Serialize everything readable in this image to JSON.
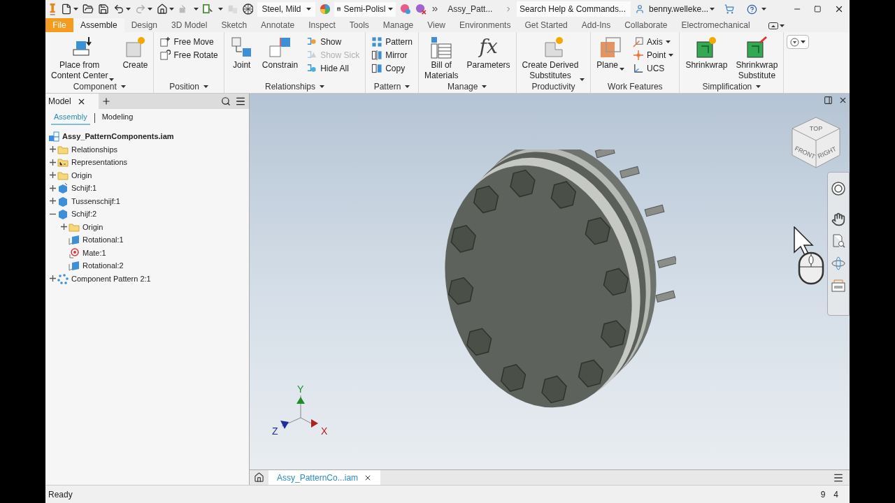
{
  "title_bar": {
    "material": "Steel, Mild",
    "appearance": "Semi-Polisl",
    "document_title": "Assy_Patt...",
    "search": {
      "placeholder": "Search Help & Commands..."
    },
    "user": "benny.welleke..."
  },
  "tabs": [
    {
      "label": "File",
      "kind": "file",
      "selected": false
    },
    {
      "label": "Assemble",
      "kind": "tab",
      "selected": true
    },
    {
      "label": "Design",
      "kind": "tab",
      "selected": false
    },
    {
      "label": "3D Model",
      "kind": "tab",
      "selected": false
    },
    {
      "label": "Sketch",
      "kind": "tab",
      "selected": false
    },
    {
      "label": "Annotate",
      "kind": "tab",
      "selected": false
    },
    {
      "label": "Inspect",
      "kind": "tab",
      "selected": false
    },
    {
      "label": "Tools",
      "kind": "tab",
      "selected": false
    },
    {
      "label": "Manage",
      "kind": "tab",
      "selected": false
    },
    {
      "label": "View",
      "kind": "tab",
      "selected": false
    },
    {
      "label": "Environments",
      "kind": "tab",
      "selected": false
    },
    {
      "label": "Get Started",
      "kind": "tab",
      "selected": false
    },
    {
      "label": "Add-Ins",
      "kind": "tab",
      "selected": false
    },
    {
      "label": "Collaborate",
      "kind": "tab",
      "selected": false
    },
    {
      "label": "Electromechanical",
      "kind": "tab",
      "selected": false
    }
  ],
  "ribbon": [
    {
      "title": "Component",
      "menu": true,
      "tools": [
        {
          "label": "Place from\nContent Center",
          "kind": "large",
          "dropdown": true,
          "disabled": false
        },
        {
          "label": "Create",
          "kind": "large",
          "dropdown": false,
          "disabled": false
        }
      ]
    },
    {
      "title": "Position",
      "menu": true,
      "tools": [
        {
          "label": "Free Move",
          "kind": "small",
          "dropdown": false,
          "disabled": false
        },
        {
          "label": "Free Rotate",
          "kind": "small",
          "dropdown": false,
          "disabled": false
        }
      ]
    },
    {
      "title": "Relationships",
      "menu": true,
      "tools": [
        {
          "label": "Joint",
          "kind": "large",
          "dropdown": false,
          "disabled": false
        },
        {
          "label": "Constrain",
          "kind": "large",
          "dropdown": false,
          "disabled": false
        },
        {
          "label": "Show",
          "kind": "small",
          "dropdown": false,
          "disabled": false
        },
        {
          "label": "Show Sick",
          "kind": "small",
          "dropdown": false,
          "disabled": true
        },
        {
          "label": "Hide All",
          "kind": "small",
          "dropdown": false,
          "disabled": false
        }
      ]
    },
    {
      "title": "Pattern",
      "menu": true,
      "tools": [
        {
          "label": "Pattern",
          "kind": "small",
          "dropdown": false,
          "disabled": false
        },
        {
          "label": "Mirror",
          "kind": "small",
          "dropdown": false,
          "disabled": false
        },
        {
          "label": "Copy",
          "kind": "small",
          "dropdown": false,
          "disabled": false
        }
      ]
    },
    {
      "title": "Manage",
      "menu": true,
      "tools": [
        {
          "label": "Bill of\nMaterials",
          "kind": "large",
          "dropdown": false,
          "disabled": false
        },
        {
          "label": "Parameters",
          "kind": "large",
          "glyph": "fx",
          "dropdown": false,
          "disabled": false
        }
      ]
    },
    {
      "title": "Productivity",
      "menu": false,
      "tools": [
        {
          "label": "Create Derived\nSubstitutes",
          "kind": "large",
          "dropdown": true,
          "disabled": false
        }
      ]
    },
    {
      "title": "Work Features",
      "menu": false,
      "tools": [
        {
          "label": "Plane",
          "kind": "large",
          "dropdown": true,
          "disabled": false
        },
        {
          "label": "Axis",
          "kind": "small",
          "dropdown": true,
          "disabled": false
        },
        {
          "label": "Point",
          "kind": "small",
          "dropdown": true,
          "disabled": false
        },
        {
          "label": "UCS",
          "kind": "small",
          "dropdown": false,
          "disabled": false
        }
      ]
    },
    {
      "title": "Simplification",
      "menu": true,
      "tools": [
        {
          "label": "Shrinkwrap",
          "kind": "large",
          "dropdown": false,
          "disabled": false
        },
        {
          "label": "Shrinkwrap\nSubstitute",
          "kind": "large",
          "dropdown": false,
          "disabled": false
        }
      ]
    }
  ],
  "browser": {
    "tab": "Model",
    "subtabs": [
      {
        "label": "Assembly",
        "selected": true
      },
      {
        "label": "Modeling",
        "selected": false
      }
    ],
    "tree": {
      "label": "Assy_PatternComponents.iam",
      "kind": "assembly",
      "children": [
        {
          "label": "Relationships",
          "kind": "folder",
          "expanded": false
        },
        {
          "label": "Representations",
          "kind": "representations",
          "expanded": false
        },
        {
          "label": "Origin",
          "kind": "folder",
          "expanded": false
        },
        {
          "label": "Schijf:1",
          "kind": "part-grounded",
          "expanded": false
        },
        {
          "label": "Tussenschijf:1",
          "kind": "part",
          "expanded": false
        },
        {
          "label": "Schijf:2",
          "kind": "part",
          "expanded": true,
          "children": [
            {
              "label": "Origin",
              "kind": "folder",
              "expanded": false
            },
            {
              "label": "Rotational:1",
              "kind": "rotational"
            },
            {
              "label": "Mate:1",
              "kind": "mate"
            },
            {
              "label": "Rotational:2",
              "kind": "rotational"
            }
          ]
        },
        {
          "label": "Component Pattern 2:1",
          "kind": "pattern",
          "expanded": false
        }
      ]
    }
  },
  "viewport": {
    "viewcube": [
      "TOP",
      "FRONT",
      "RIGHT"
    ],
    "axes": [
      "Y",
      "Z",
      "X"
    ]
  },
  "document_tabs": [
    {
      "label": "Assy_PatternCo...iam",
      "selected": true
    }
  ],
  "status_bar": {
    "message": "Ready",
    "values": [
      "9",
      "4"
    ]
  }
}
